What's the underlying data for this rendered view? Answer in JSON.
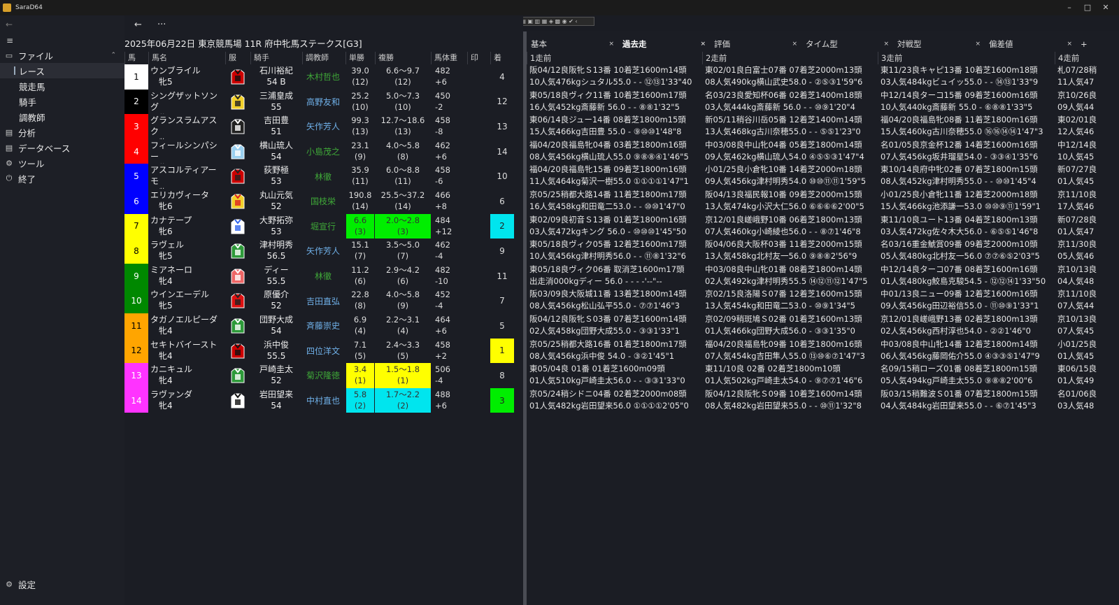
{
  "window": {
    "title": "SaraD64",
    "minimize": "–",
    "maximize": "□",
    "close": "✕"
  },
  "toolbar_mini": "▤ ▣ ▥ ▦ ◈ ▩ ◉ ✔ ‹",
  "nav": {
    "back": "←",
    "menu": "≡"
  },
  "sidebar": {
    "file_icon": "▭",
    "file": "ファイル",
    "file_caret": "⌃",
    "race": "レース",
    "horse": "競走馬",
    "jockey": "騎手",
    "trainer": "調教師",
    "analysis_icon": "▤",
    "analysis": "分析",
    "db_icon": "▤",
    "db": "データベース",
    "tool_icon": "⚙",
    "tool": "ツール",
    "exit_icon": "⏻",
    "exit": "終了",
    "settings_icon": "⚙",
    "settings": "設定"
  },
  "topnav": {
    "back": "←",
    "more": "···"
  },
  "race_title": "2025年06月22日 東京競馬場 11R 府中牝馬ステークス[G3]",
  "headers": [
    "馬",
    "馬名",
    "服",
    "騎手",
    "調教師",
    "単勝",
    "複勝",
    "馬体重",
    "印",
    "着"
  ],
  "rows": [
    {
      "num": "1",
      "name": "ウンブライル",
      "sex": "牝5",
      "jockey": "石川裕紀",
      "jw": "54 B",
      "trainer": "木村哲也",
      "tcolor": "#3fa838",
      "odds": "39.0",
      "oddsr": "(12)",
      "place": "6.6～9.7",
      "placer": "(12)",
      "wt": "482",
      "wtd": "+6",
      "fin": "4",
      "bg": "#ffffff",
      "fg": "#000000",
      "hi": "",
      "fbg": ""
    },
    {
      "num": "2",
      "name": "シングザットソング",
      "sex": "牝5",
      "jockey": "三浦皇成",
      "jw": "55",
      "trainer": "高野友和",
      "tcolor": "#6fb0e8",
      "odds": "25.2",
      "oddsr": "(10)",
      "place": "5.0～7.3",
      "placer": "(10)",
      "wt": "450",
      "wtd": "-2",
      "fin": "12",
      "bg": "#000000",
      "fg": "#ffffff",
      "hi": "",
      "fbg": ""
    },
    {
      "num": "3",
      "name": "グランスラムアスク",
      "sex": "牝6",
      "jockey": "吉田豊",
      "jw": "51",
      "trainer": "矢作芳人",
      "tcolor": "#6fb0e8",
      "odds": "99.3",
      "oddsr": "(13)",
      "place": "12.7～18.6",
      "placer": "(13)",
      "wt": "458",
      "wtd": "-8",
      "fin": "13",
      "bg": "#ff0000",
      "fg": "#ffffff",
      "hi": "",
      "fbg": ""
    },
    {
      "num": "4",
      "name": "フィールシンパシー",
      "sex": "牝6",
      "jockey": "横山琉人",
      "jw": "54",
      "trainer": "小島茂之",
      "tcolor": "#3fa838",
      "odds": "23.1",
      "oddsr": "(9)",
      "place": "4.0～5.8",
      "placer": "(8)",
      "wt": "462",
      "wtd": "+6",
      "fin": "14",
      "bg": "#ff0000",
      "fg": "#ffffff",
      "hi": "",
      "fbg": ""
    },
    {
      "num": "5",
      "name": "アスコルティアーモ",
      "sex": "牝5",
      "jockey": "荻野極",
      "jw": "53",
      "trainer": "林徹",
      "tcolor": "#3fa838",
      "odds": "35.9",
      "oddsr": "(11)",
      "place": "6.0～8.8",
      "placer": "(11)",
      "wt": "458",
      "wtd": "-6",
      "fin": "10",
      "bg": "#0000ff",
      "fg": "#ffffff",
      "hi": "",
      "fbg": ""
    },
    {
      "num": "6",
      "name": "エリカヴィータ",
      "sex": "牝6",
      "jockey": "丸山元気",
      "jw": "52",
      "trainer": "国枝栄",
      "tcolor": "#3fa838",
      "odds": "190.8",
      "oddsr": "(14)",
      "place": "25.5～37.2",
      "placer": "(14)",
      "wt": "466",
      "wtd": "+8",
      "fin": "6",
      "bg": "#0000ff",
      "fg": "#ffffff",
      "hi": "",
      "fbg": ""
    },
    {
      "num": "7",
      "name": "カナテープ",
      "sex": "牝6",
      "jockey": "大野拓弥",
      "jw": "53",
      "trainer": "堀宣行",
      "tcolor": "#3fa838",
      "odds": "6.6",
      "oddsr": "(3)",
      "place": "2.0～2.8",
      "placer": "(3)",
      "wt": "484",
      "wtd": "+12",
      "fin": "2",
      "bg": "#ffff00",
      "fg": "#000000",
      "hi": "#00ee00",
      "fbg": "#00e5ee"
    },
    {
      "num": "8",
      "name": "ラヴェル",
      "sex": "牝5",
      "jockey": "津村明秀",
      "jw": "56.5",
      "trainer": "矢作芳人",
      "tcolor": "#6fb0e8",
      "odds": "15.1",
      "oddsr": "(7)",
      "place": "3.5～5.0",
      "placer": "(7)",
      "wt": "462",
      "wtd": "-4",
      "fin": "9",
      "bg": "#ffff00",
      "fg": "#000000",
      "hi": "",
      "fbg": ""
    },
    {
      "num": "9",
      "name": "ミアネーロ",
      "sex": "牝4",
      "jockey": "ディー",
      "jw": "55.5",
      "trainer": "林徹",
      "tcolor": "#3fa838",
      "odds": "11.2",
      "oddsr": "(6)",
      "place": "2.9～4.2",
      "placer": "(6)",
      "wt": "482",
      "wtd": "-10",
      "fin": "11",
      "bg": "#008800",
      "fg": "#ffffff",
      "hi": "",
      "fbg": ""
    },
    {
      "num": "10",
      "name": "ウインエーデル",
      "sex": "牝5",
      "jockey": "原優介",
      "jw": "52",
      "trainer": "吉田直弘",
      "tcolor": "#6fb0e8",
      "odds": "22.8",
      "oddsr": "(8)",
      "place": "4.0～5.8",
      "placer": "(9)",
      "wt": "452",
      "wtd": "-4",
      "fin": "7",
      "bg": "#008800",
      "fg": "#ffffff",
      "hi": "",
      "fbg": ""
    },
    {
      "num": "11",
      "name": "タガノエルピーダ",
      "sex": "牝4",
      "jockey": "団野大成",
      "jw": "54",
      "trainer": "斉藤崇史",
      "tcolor": "#6fb0e8",
      "odds": "6.9",
      "oddsr": "(4)",
      "place": "2.2～3.1",
      "placer": "(4)",
      "wt": "464",
      "wtd": "+6",
      "fin": "5",
      "bg": "#ffa500",
      "fg": "#000000",
      "hi": "",
      "fbg": ""
    },
    {
      "num": "12",
      "name": "セキトバイースト",
      "sex": "牝4",
      "jockey": "浜中俊",
      "jw": "55.5",
      "trainer": "四位洋文",
      "tcolor": "#6fb0e8",
      "odds": "7.1",
      "oddsr": "(5)",
      "place": "2.4～3.3",
      "placer": "(5)",
      "wt": "458",
      "wtd": "+2",
      "fin": "1",
      "bg": "#ffa500",
      "fg": "#000000",
      "hi": "",
      "fbg": "#ffff00"
    },
    {
      "num": "13",
      "name": "カニキュル",
      "sex": "牝4",
      "jockey": "戸崎圭太",
      "jw": "52",
      "trainer": "菊沢隆徳",
      "tcolor": "#3fa838",
      "odds": "3.4",
      "oddsr": "(1)",
      "place": "1.5～1.8",
      "placer": "(1)",
      "wt": "506",
      "wtd": "-4",
      "fin": "8",
      "bg": "#ff33ff",
      "fg": "#ffffff",
      "hi": "#ffff00",
      "fbg": ""
    },
    {
      "num": "14",
      "name": "ラヴァンダ",
      "sex": "牝4",
      "jockey": "岩田望来",
      "jw": "54",
      "trainer": "中村直也",
      "tcolor": "#6fb0e8",
      "odds": "5.8",
      "oddsr": "(2)",
      "place": "1.7～2.2",
      "placer": "(2)",
      "wt": "488",
      "wtd": "+6",
      "fin": "3",
      "bg": "#ff33ff",
      "fg": "#ffffff",
      "hi": "#00e5ee",
      "fbg": "#00ee00"
    }
  ],
  "tabs": [
    {
      "label": "基本",
      "x": "×"
    },
    {
      "label": "過去走",
      "x": "×"
    },
    {
      "label": "評価",
      "x": "×"
    },
    {
      "label": "タイム型",
      "x": "×"
    },
    {
      "label": "対戦型",
      "x": "×"
    },
    {
      "label": "偏差値",
      "x": "×"
    }
  ],
  "tab_add": "+",
  "past_headers": [
    "1走前",
    "2走前",
    "3走前",
    "4走前"
  ],
  "past": [
    [
      [
        "阪04/12良阪牝Ｓ13番 10着芝1600m14頭",
        "10人気476kgシュタル55.0 - - ⑫⑬1'33\"40"
      ],
      [
        "東02/01良白富士07番 07着芝2000m13頭",
        "08人気490kg横山武史58.0 - ②⑤③1'59\"6"
      ],
      [
        "東11/23良キャピ13番 10着芝1600m18頭",
        "03人気484kgビュイッ55.0 - - ⑭⑬1'33\"9"
      ],
      [
        "札07/28稍",
        "11人気47"
      ]
    ],
    [
      [
        "東05/18良ヴィク11番 10着芝1600m17頭",
        "16人気452kg斎藤新 56.0 - - ⑧⑧1'32\"5"
      ],
      [
        "名03/23良愛知杯06番 02着芝1400m18頭",
        "03人気444kg斎藤新 56.0 - - ⑩⑨1'20\"4"
      ],
      [
        "中12/14良ターコ15番 09着芝1600m16頭",
        "10人気440kg斎藤新 55.0 - ⑥⑧⑧1'33\"5"
      ],
      [
        "京10/26良",
        "09人気44"
      ]
    ],
    [
      [
        "東06/14良ジュー14番 08着芝1800m15頭",
        "15人気466kg吉田豊 55.0 - ⑨⑩⑩1'48\"8"
      ],
      [
        "新05/11稍谷川岳05番 12着芝1400m14頭",
        "13人気468kg古川奈穂55.0 - - ⑤⑤1'23\"0"
      ],
      [
        "福04/20良福島牝08番 11着芝1800m16頭",
        "15人気460kg古川奈穂55.0 ⑯⑯⑭⑭1'47\"3"
      ],
      [
        "東02/01良",
        "12人気46"
      ]
    ],
    [
      [
        "福04/20良福島牝04番 03着芝1800m16頭",
        "08人気456kg横山琉人55.0 ⑨⑧⑧④1'46\"5"
      ],
      [
        "中03/08良中山牝04番 05着芝1800m14頭",
        "09人気462kg横山琉人54.0 ④⑤⑤③1'47\"4"
      ],
      [
        "名01/05良京金杯12番 14着芝1600m16頭",
        "07人気456kg坂井瑠星54.0 - ③③④1'35\"6"
      ],
      [
        "中12/14良",
        "10人気45"
      ]
    ],
    [
      [
        "福04/20良福島牝15番 09着芝1800m16頭",
        "11人気464kg菊沢一樹55.0 ①①①①1'47\"1"
      ],
      [
        "小01/25良小倉牝10番 14着芝2000m18頭",
        "09人気456kg津村明秀54.0 ⑩⑩⑪⑪1'59\"5"
      ],
      [
        "東10/14良府中牝02番 07着芝1800m15頭",
        "08人気452kg津村明秀55.0 - - ⑩⑩1'45\"4"
      ],
      [
        "新07/27良",
        "01人気45"
      ]
    ],
    [
      [
        "京05/25稍都大路14番 11着芝1800m17頭",
        "16人気458kg和田竜二53.0 - - ⑩⑩1'47\"0"
      ],
      [
        "阪04/13良福民報10番 09着芝2000m15頭",
        "13人気474kg小沢大仁56.0 ⑥⑥⑥⑥2'00\"5"
      ],
      [
        "小01/25良小倉牝11番 12着芝2000m18頭",
        "15人気466kg池添謙一53.0 ⑩⑩⑨⑪1'59\"1"
      ],
      [
        "京11/10良",
        "17人気46"
      ]
    ],
    [
      [
        "東02/09良初音Ｓ13番 01着芝1800m16頭",
        "03人気472kgキング 56.0 - ⑩⑩⑩1'45\"50"
      ],
      [
        "京12/01良嵯峨野10番 06着芝1800m13頭",
        "07人気460kg小崎綾也56.0 - - ⑧⑦1'46\"8"
      ],
      [
        "東11/10良ユート13番 04着芝1800m13頭",
        "03人気472kg佐々木大56.0 - ⑥⑤⑤1'46\"8"
      ],
      [
        "新07/28良",
        "01人気47"
      ]
    ],
    [
      [
        "東05/18良ヴィク05番 12着芝1600m17頭",
        "10人気456kg津村明秀56.0 - - ⑪⑧1'32\"6"
      ],
      [
        "阪04/06良大阪杯03番 11着芝2000m15頭",
        "13人気458kg北村友一56.0 ⑨⑧⑧2'56\"9"
      ],
      [
        "名03/16重金鯱賞09番 09着芝2000m10頭",
        "05人気480kg北村友一56.0 ⑦⑦⑥⑤2'03\"5"
      ],
      [
        "京11/30良",
        "05人気46"
      ]
    ],
    [
      [
        "東05/18良ヴィク06番 取消芝1600m17頭",
        "出走消000kgディー 56.0 - - - -'--\"--"
      ],
      [
        "中03/08良中山牝01番 08着芝1800m14頭",
        "02人気492kg津村明秀55.5 ⑭⑫⑪⑫1'47\"5"
      ],
      [
        "中12/14良ターコ07番 08着芝1600m16頭",
        "01人気480kg鮫島克駿54.5 - ⑫⑫⑭1'33\"50"
      ],
      [
        "京10/13良",
        "04人気48"
      ]
    ],
    [
      [
        "阪03/09良大阪城11番 13着芝1800m14頭",
        "08人気456kg松山弘平55.0 - ⑦⑦1'46\"3"
      ],
      [
        "京02/15良洛陽Ｓ07番 12着芝1600m15頭",
        "13人気454kg和田竜二53.0 - ⑩⑨1'34\"5"
      ],
      [
        "中01/13良ニュー09番 12着芝1600m16頭",
        "09人気456kg田辺裕信55.0 - ⑪⑩⑨1'33\"1"
      ],
      [
        "京11/10良",
        "07人気44"
      ]
    ],
    [
      [
        "阪04/12良阪牝Ｓ03番 07着芝1600m14頭",
        "02人気458kg団野大成55.0 - ③③1'33\"1"
      ],
      [
        "京02/09稍斑鳩Ｓ02番 01着芝1600m13頭",
        "01人気466kg団野大成56.0 - ③③1'35\"0"
      ],
      [
        "京12/01良嵯峨野13番 02着芝1800m13頭",
        "02人気456kg西村淳也54.0 - ②②1'46\"0"
      ],
      [
        "京10/13良",
        "07人気45"
      ]
    ],
    [
      [
        "京05/25稍都大路16番 01着芝1800m17頭",
        "08人気456kg浜中俊 54.0 - ③②1'45\"1"
      ],
      [
        "福04/20良福島牝09番 10着芝1800m16頭",
        "07人気454kg吉田隼人55.0 ⑬⑩⑥⑦1'47\"3"
      ],
      [
        "中03/08良中山牝14番 12着芝1800m14頭",
        "06人気456kg藤岡佑介55.0 ④③③⑤1'47\"9"
      ],
      [
        "小01/25良",
        "01人気45"
      ]
    ],
    [
      [
        "東05/04良 01番 01着芝1600m09頭",
        "01人気510kg戸崎圭太56.0 - - ③③1'33\"0"
      ],
      [
        "東11/10良 02番 02着芝1800m10頭",
        "01人気502kg戸崎圭太54.0 - ⑨⑦⑦1'46\"6"
      ],
      [
        "名09/15稍ローズ01番 08着芝1800m15頭",
        "05人気494kg戸崎圭太55.0 ⑨⑧⑧2'00\"6"
      ],
      [
        "東06/15良",
        "01人気49"
      ]
    ],
    [
      [
        "京05/24稍シドニ04番 02着芝2000m08頭",
        "01人気482kg岩田望来56.0 ①①①①2'05\"0"
      ],
      [
        "阪04/12良阪牝Ｓ09番 10着芝1600m14頭",
        "08人気482kg岩田望来55.0 - - ⑩⑪1'32\"8"
      ],
      [
        "阪03/15稍難波Ｓ01番 07着芝1800m15頭",
        "04人気484kg岩田望来55.0 - - ⑥⑦1'45\"3"
      ],
      [
        "名01/06良",
        "03人気48"
      ]
    ]
  ]
}
